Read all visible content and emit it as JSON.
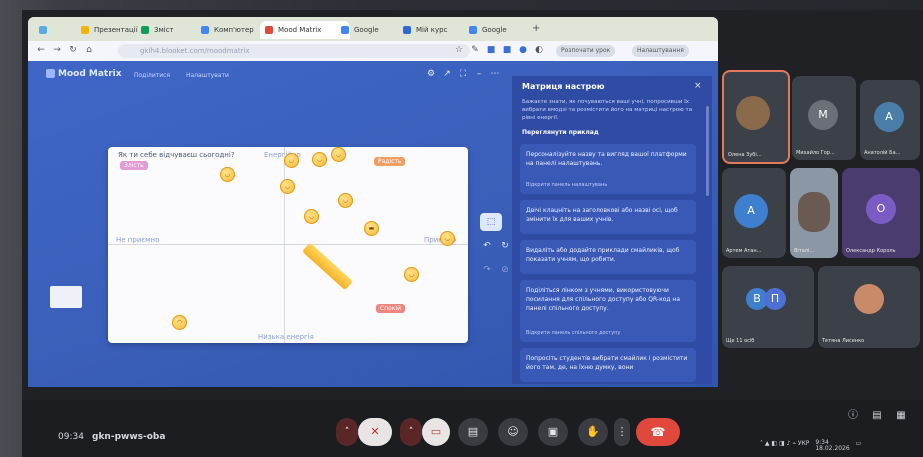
{
  "browser": {
    "tabs": [
      {
        "label": "",
        "color": "#5aa9e6"
      },
      {
        "label": "Презентації",
        "color": "#f4b400"
      },
      {
        "label": "Зміст",
        "color": "#0f9d58"
      },
      {
        "label": "Комп'ютер",
        "color": "#4285f4"
      },
      {
        "label": "Mood Matrix",
        "color": "#e0483e"
      },
      {
        "label": "Google",
        "color": "#4285f4"
      },
      {
        "label": "Мій курс",
        "color": "#3367d6"
      },
      {
        "label": "Google",
        "color": "#4285f4"
      }
    ],
    "url": "gklh4.blooket.com/moodmatrix",
    "pill_1": "Розпочати урок",
    "pill_2": "Налаштування"
  },
  "app": {
    "title": "Mood Matrix",
    "menu_1": "Поділитися",
    "menu_2": "Налаштувати",
    "matrix": {
      "question": "Як ти себе відчуваєш сьогодні?",
      "top_label": "Енергійно",
      "left_label": "Не приємно",
      "right_label": "Приємно",
      "bottom_label": "Низька енергія",
      "tag_top_left": "Злість",
      "tag_top_right": "Радість",
      "tag_bottom_right": "Спокій"
    }
  },
  "panel": {
    "title": "Матриця настрою",
    "intro": "Бажаєте знати, як почуваються ваші учні, попросивши їх вибрати емодзі та розмістити його на матриці настрою та рівні енергії.",
    "link": "Переглянути приклад",
    "cards": [
      {
        "text": "Персоналізуйте назву та вигляд вашої платформи на панелі налаштувань.",
        "link": "Відкрити панель налаштувань"
      },
      {
        "text": "Двічі клацніть на заголовкові або назві осі, щоб змінити їх для ваших учнів.",
        "link": ""
      },
      {
        "text": "Видаліть або додайте приклади смайликів, щоб показати учням, що робити.",
        "link": ""
      },
      {
        "text": "Поділіться лінком з учнями, використовуючи посилання для спільного доступу або QR-код на панелі спільного доступу.",
        "link": "Відкрити панель спільного доступу"
      },
      {
        "text": "Попросіть студентів вибрати смайлик і розмістити його там, де, на їхню думку, вони",
        "link": ""
      }
    ]
  },
  "participants": [
    {
      "name": "Олена Зубі...",
      "initial": "",
      "color": "#8a6a4a"
    },
    {
      "name": "Михайло Гор...",
      "initial": "М",
      "color": "#6b6f78"
    },
    {
      "name": "Анатолій Ба...",
      "initial": "А",
      "color": "#4a7ea8"
    },
    {
      "name": "Артем Атан...",
      "initial": "А",
      "color": "#3f7fcf"
    },
    {
      "name": "Віталі...",
      "initial": "",
      "color": "#7d8a98"
    },
    {
      "name": "Олександр Король",
      "initial": "О",
      "color": "#7b5cc4"
    },
    {
      "name": "Ще 11 осіб",
      "initial": "В",
      "color": "#3f7fcf"
    },
    {
      "name": "Тетяна Лисенко",
      "initial": "",
      "color": "#c98a6a"
    }
  ],
  "group_second_initial": "П",
  "meeting": {
    "time": "09:34",
    "code": "gkn-pwws-oba"
  },
  "tray": {
    "lang": "УКР",
    "clock": "9:34",
    "date": "18.02.2026"
  }
}
